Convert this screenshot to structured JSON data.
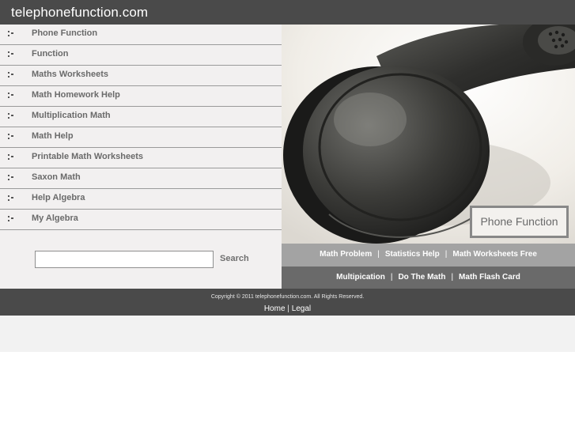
{
  "site": {
    "title": "telephonefunction.com"
  },
  "nav": {
    "items": [
      {
        "label": "Phone Function"
      },
      {
        "label": "Function"
      },
      {
        "label": "Maths Worksheets"
      },
      {
        "label": "Math Homework Help"
      },
      {
        "label": "Multiplication Math"
      },
      {
        "label": "Math Help"
      },
      {
        "label": "Printable Math Worksheets"
      },
      {
        "label": "Saxon Math"
      },
      {
        "label": "Help Algebra"
      },
      {
        "label": "My Algebra"
      }
    ]
  },
  "search": {
    "value": "",
    "button_label": "Search"
  },
  "hero": {
    "label": "Phone Function"
  },
  "links_row1": [
    {
      "label": "Math Problem"
    },
    {
      "label": "Statistics Help"
    },
    {
      "label": "Math Worksheets Free"
    }
  ],
  "links_row2": [
    {
      "label": "Multipication"
    },
    {
      "label": "Do The Math"
    },
    {
      "label": "Math Flash Card"
    }
  ],
  "separator": "|",
  "footer": {
    "copyright": "Copyright © 2011 telephonefunction.com. All Rights Reserved.",
    "home_label": "Home",
    "divider": "|",
    "legal_label": "Legal"
  },
  "colors": {
    "header_bg": "#4a4a4a",
    "sidebar_bg": "#f2f0f0",
    "link_bar_light": "#a3a3a3",
    "link_bar_dark": "#6a6a6a"
  }
}
